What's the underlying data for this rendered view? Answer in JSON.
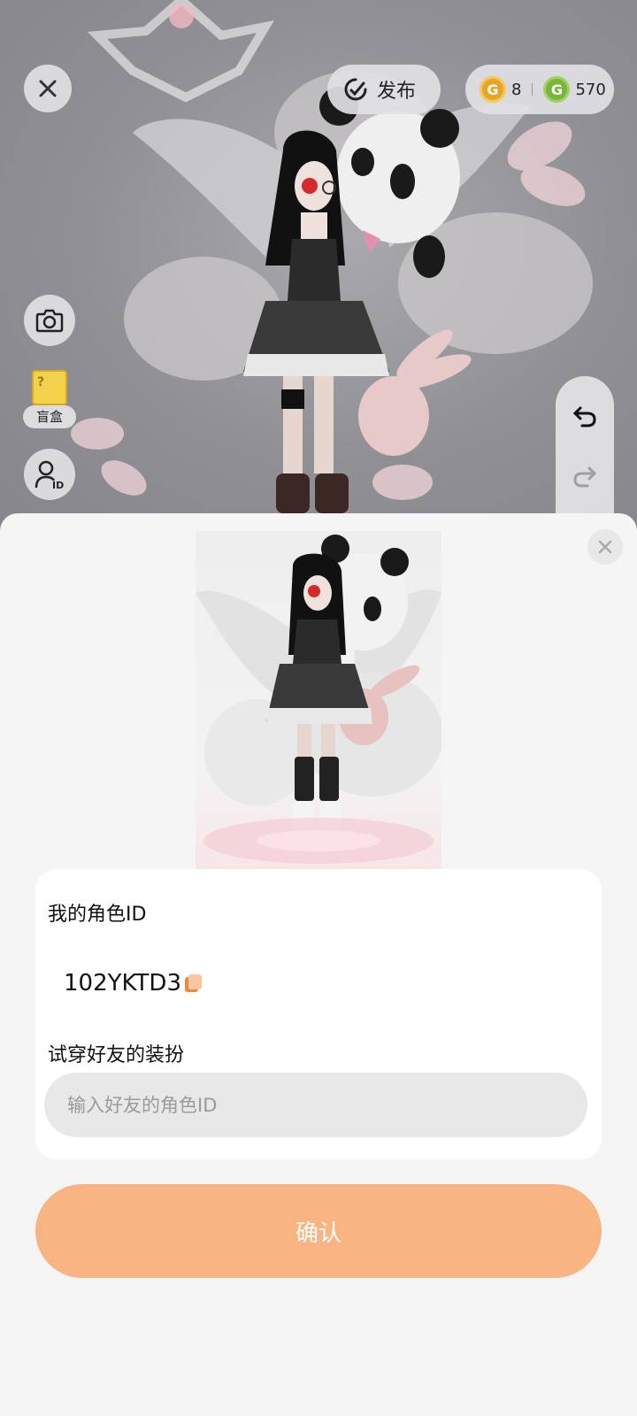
{
  "header": {
    "publish_label": "发布",
    "gold_coins": "8",
    "green_coins": "570",
    "gold_coin_symbol": "G",
    "green_coin_symbol": "G"
  },
  "side_tools": {
    "blindbox_label": "盲盒",
    "id_badge": "ID"
  },
  "sheet": {
    "my_id_label": "我的角色ID",
    "my_id_value": "102YKTD3",
    "tryon_label": "试穿好友的装扮",
    "friend_id_placeholder": "输入好友的角色ID",
    "confirm_label": "确认"
  },
  "colors": {
    "accent_button": "#f8b583",
    "gold_coin": "#e7a526",
    "green_coin": "#7bb53a",
    "copy_icon": "#f08a3a"
  }
}
